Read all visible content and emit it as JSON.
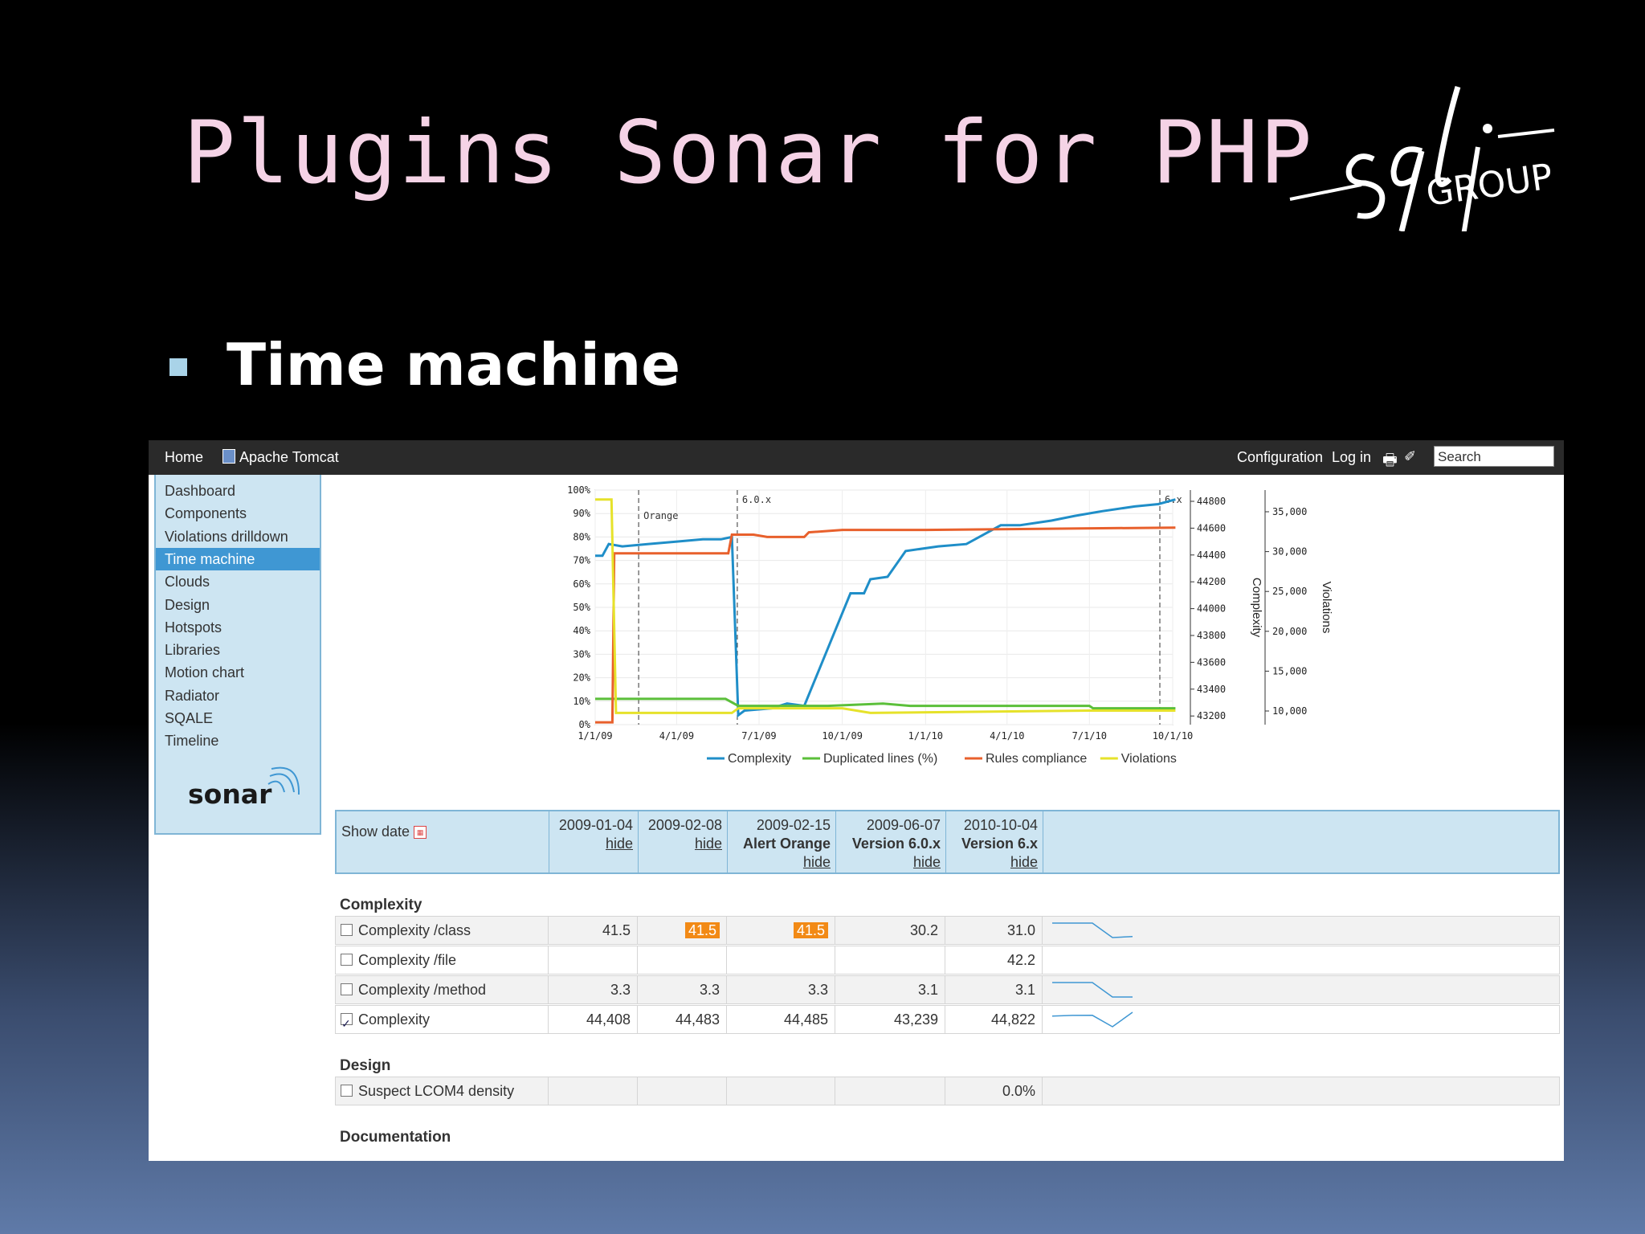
{
  "slide": {
    "title": "Plugins Sonar for PHP",
    "bullet": "Time machine",
    "logo": {
      "main": "sqli",
      "sub": "GROUP"
    }
  },
  "topbar": {
    "home": "Home",
    "project": "Apache Tomcat",
    "configuration": "Configuration",
    "login": "Log in",
    "search_value": "Search",
    "icons": [
      "print-icon",
      "wrench-icon"
    ]
  },
  "sidebar": {
    "items": [
      {
        "label": "Dashboard"
      },
      {
        "label": "Components"
      },
      {
        "label": "Violations drilldown"
      },
      {
        "label": "Time machine",
        "selected": true
      },
      {
        "label": "Clouds"
      },
      {
        "label": "Design"
      },
      {
        "label": "Hotspots"
      },
      {
        "label": "Libraries"
      },
      {
        "label": "Motion chart"
      },
      {
        "label": "Radiator"
      },
      {
        "label": "SQALE"
      },
      {
        "label": "Timeline"
      }
    ],
    "logo_text": "sonar"
  },
  "chart_data": {
    "type": "line",
    "x_ticks": [
      "1/1/09",
      "4/1/09",
      "7/1/09",
      "10/1/09",
      "1/1/10",
      "4/1/10",
      "7/1/10",
      "10/1/10"
    ],
    "left_axis_ticks": [
      "100%",
      "90%",
      "80%",
      "70%",
      "60%",
      "50%",
      "40%",
      "30%",
      "20%",
      "10%",
      "0%"
    ],
    "complexity_axis_ticks": [
      "44800",
      "44600",
      "44400",
      "44200",
      "44000",
      "43800",
      "43600",
      "43400",
      "43200"
    ],
    "violations_axis_ticks": [
      "35,000",
      "30,000",
      "25,000",
      "20,000",
      "15,000",
      "10,000"
    ],
    "complexity_axis_label": "Complexity",
    "violations_axis_label": "Violations",
    "markers": [
      {
        "label": "Orange",
        "date": "2009-02-15"
      },
      {
        "label": "6.0.x",
        "date": "2009-06-07"
      },
      {
        "label": "6.x",
        "date": "2010-10-04"
      }
    ],
    "series": [
      {
        "name": "Complexity",
        "color": "#1f8ec8",
        "points": [
          [
            "2009-01-01",
            72
          ],
          [
            "2009-01-09",
            72
          ],
          [
            "2009-01-16",
            77
          ],
          [
            "2009-01-31",
            76
          ],
          [
            "2009-02-28",
            77
          ],
          [
            "2009-03-31",
            78
          ],
          [
            "2009-04-30",
            79
          ],
          [
            "2009-05-20",
            79
          ],
          [
            "2009-06-01",
            80
          ],
          [
            "2009-06-08",
            4
          ],
          [
            "2009-06-15",
            6
          ],
          [
            "2009-07-15",
            7
          ],
          [
            "2009-08-01",
            9
          ],
          [
            "2009-08-20",
            8
          ],
          [
            "2009-10-10",
            56
          ],
          [
            "2009-10-25",
            56
          ],
          [
            "2009-11-01",
            62
          ],
          [
            "2009-11-20",
            63
          ],
          [
            "2009-12-10",
            74
          ],
          [
            "2010-01-15",
            76
          ],
          [
            "2010-02-15",
            77
          ],
          [
            "2010-03-25",
            85
          ],
          [
            "2010-04-15",
            85
          ],
          [
            "2010-05-20",
            87
          ],
          [
            "2010-06-15",
            89
          ],
          [
            "2010-07-15",
            91
          ],
          [
            "2010-08-20",
            93
          ],
          [
            "2010-09-15",
            94
          ],
          [
            "2010-10-04",
            96
          ]
        ]
      },
      {
        "name": "Duplicated lines (%)",
        "color": "#5bbf3a",
        "points": [
          [
            "2009-01-01",
            11
          ],
          [
            "2009-05-25",
            11
          ],
          [
            "2009-06-08",
            8
          ],
          [
            "2009-07-15",
            8
          ],
          [
            "2009-09-15",
            8
          ],
          [
            "2009-11-15",
            9
          ],
          [
            "2009-12-15",
            8
          ],
          [
            "2010-03-15",
            8
          ],
          [
            "2010-07-01",
            8
          ],
          [
            "2010-07-05",
            7
          ],
          [
            "2010-10-04",
            7
          ]
        ]
      },
      {
        "name": "Rules compliance",
        "color": "#e8602c",
        "points": [
          [
            "2009-01-01",
            1
          ],
          [
            "2009-01-20",
            1
          ],
          [
            "2009-01-22",
            73
          ],
          [
            "2009-05-28",
            73
          ],
          [
            "2009-06-01",
            81
          ],
          [
            "2009-06-25",
            81
          ],
          [
            "2009-07-10",
            80
          ],
          [
            "2009-08-20",
            80
          ],
          [
            "2009-08-25",
            82
          ],
          [
            "2009-10-01",
            83
          ],
          [
            "2010-01-01",
            83
          ],
          [
            "2010-10-04",
            84
          ]
        ]
      },
      {
        "name": "Violations",
        "color": "#e6e22a",
        "points": [
          [
            "2009-01-01",
            96
          ],
          [
            "2009-01-19",
            96
          ],
          [
            "2009-01-24",
            5
          ],
          [
            "2009-06-01",
            5
          ],
          [
            "2009-06-08",
            7
          ],
          [
            "2009-10-01",
            7
          ],
          [
            "2009-11-01",
            5
          ],
          [
            "2010-07-01",
            6
          ],
          [
            "2010-10-04",
            6
          ]
        ]
      }
    ]
  },
  "table": {
    "show_date_label": "Show date",
    "hide_label": "hide",
    "columns": [
      {
        "date": "2009-01-04",
        "event": ""
      },
      {
        "date": "2009-02-08",
        "event": ""
      },
      {
        "date": "2009-02-15",
        "event": "Alert Orange"
      },
      {
        "date": "2009-06-07",
        "event": "Version 6.0.x"
      },
      {
        "date": "2010-10-04",
        "event": "Version 6.x"
      }
    ],
    "sections": [
      {
        "title": "Complexity",
        "rows": [
          {
            "label": "Complexity /class",
            "checked": false,
            "values": [
              "41.5",
              "41.5",
              "41.5",
              "30.2",
              "31.0"
            ],
            "alerts": [
              false,
              true,
              true,
              false,
              false
            ],
            "trend": [
              41.5,
              41.5,
              41.5,
              30.2,
              31.0
            ]
          },
          {
            "label": "Complexity /file",
            "checked": false,
            "values": [
              "",
              "",
              "",
              "",
              "42.2"
            ],
            "alerts": [
              false,
              false,
              false,
              false,
              false
            ],
            "trend": []
          },
          {
            "label": "Complexity /method",
            "checked": false,
            "values": [
              "3.3",
              "3.3",
              "3.3",
              "3.1",
              "3.1"
            ],
            "alerts": [
              false,
              false,
              false,
              false,
              false
            ],
            "trend": [
              3.3,
              3.3,
              3.3,
              3.1,
              3.1
            ]
          },
          {
            "label": "Complexity",
            "checked": true,
            "values": [
              "44,408",
              "44,483",
              "44,485",
              "43,239",
              "44,822"
            ],
            "alerts": [
              false,
              false,
              false,
              false,
              false
            ],
            "trend": [
              44408,
              44483,
              44485,
              43239,
              44822
            ]
          }
        ]
      },
      {
        "title": "Design",
        "rows": [
          {
            "label": "Suspect LCOM4 density",
            "checked": false,
            "values": [
              "",
              "",
              "",
              "",
              "0.0%"
            ],
            "alerts": [
              false,
              false,
              false,
              false,
              false
            ],
            "trend": []
          }
        ]
      },
      {
        "title": "Documentation",
        "rows": []
      }
    ]
  }
}
